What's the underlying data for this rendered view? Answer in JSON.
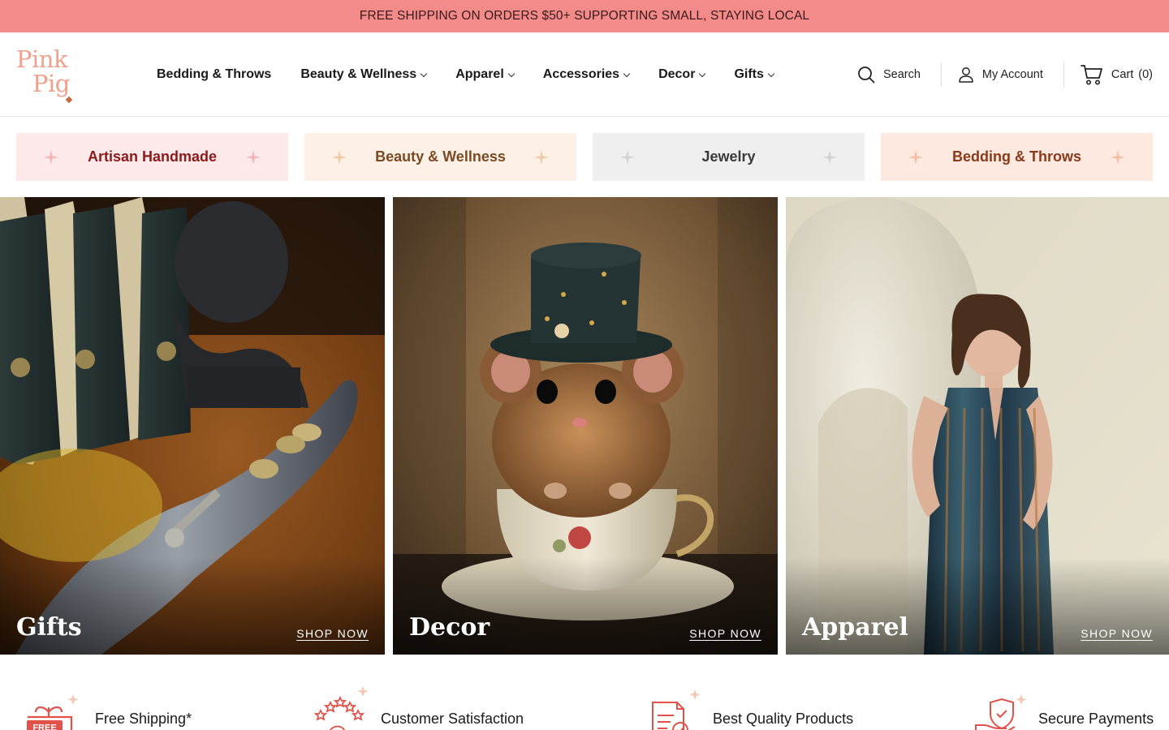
{
  "announcement": "FREE SHIPPING ON ORDERS $50+ SUPPORTING SMALL, STAYING LOCAL",
  "logo": {
    "line1": "Pink",
    "line2": "Pig"
  },
  "nav": {
    "items": [
      {
        "label": "Bedding & Throws",
        "has_dropdown": false
      },
      {
        "label": "Beauty & Wellness",
        "has_dropdown": true
      },
      {
        "label": "Apparel",
        "has_dropdown": true
      },
      {
        "label": "Accessories",
        "has_dropdown": true
      },
      {
        "label": "Decor",
        "has_dropdown": true
      },
      {
        "label": "Gifts",
        "has_dropdown": true
      }
    ]
  },
  "header_actions": {
    "search": "Search",
    "account": "My Account",
    "cart_label": "Cart",
    "cart_count": "(0)"
  },
  "pills": [
    {
      "label": "Artisan Handmade",
      "bg": "#fde8ea",
      "color": "#8b1a1a",
      "spark": "#f3b3b8"
    },
    {
      "label": "Beauty & Wellness",
      "bg": "#fdf0e6",
      "color": "#7a4a22",
      "spark": "#f0c9a6"
    },
    {
      "label": "Jewelry",
      "bg": "#efefef",
      "color": "#3a3a3a",
      "spark": "#d2d2d2"
    },
    {
      "label": "Bedding & Throws",
      "bg": "#fde9e0",
      "color": "#8a3a1a",
      "spark": "#f2bfa6"
    }
  ],
  "tiles": [
    {
      "label": "Gifts",
      "cta": "SHOP NOW"
    },
    {
      "label": "Decor",
      "cta": "SHOP NOW"
    },
    {
      "label": "Apparel",
      "cta": "SHOP NOW"
    }
  ],
  "features": [
    {
      "label": "Free Shipping*",
      "icon": "free-shipping-icon",
      "badge": "FREE"
    },
    {
      "label": "Customer Satisfaction",
      "icon": "satisfaction-stars-icon"
    },
    {
      "label": "Best Quality Products",
      "icon": "quality-document-icon"
    },
    {
      "label": "Secure Payments",
      "icon": "secure-payment-icon"
    }
  ],
  "colors": {
    "accent": "#f48b8b",
    "icon_red": "#e0524a"
  }
}
